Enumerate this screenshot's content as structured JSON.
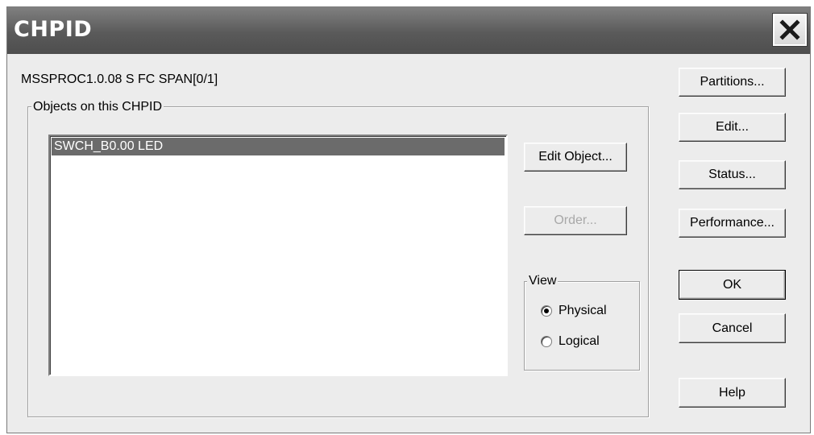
{
  "window": {
    "title": "CHPID"
  },
  "header": {
    "path_label": "MSSPROC1.0.08 S FC SPAN[0/1]"
  },
  "objects_group": {
    "title": "Objects on this CHPID",
    "items": [
      "SWCH_B0.00 LED"
    ],
    "selected_index": 0
  },
  "object_buttons": {
    "edit_object": "Edit Object...",
    "order": "Order..."
  },
  "view_group": {
    "title": "View",
    "options": [
      {
        "label": "Physical",
        "checked": true
      },
      {
        "label": "Logical",
        "checked": false
      }
    ]
  },
  "side_buttons": {
    "partitions": "Partitions...",
    "edit": "Edit...",
    "status": "Status...",
    "performance": "Performance...",
    "ok": "OK",
    "cancel": "Cancel",
    "help": "Help"
  },
  "colors": {
    "titlebar": "#5a5a5a",
    "selection": "#6b6b6b",
    "dialog_bg": "#ececec"
  }
}
